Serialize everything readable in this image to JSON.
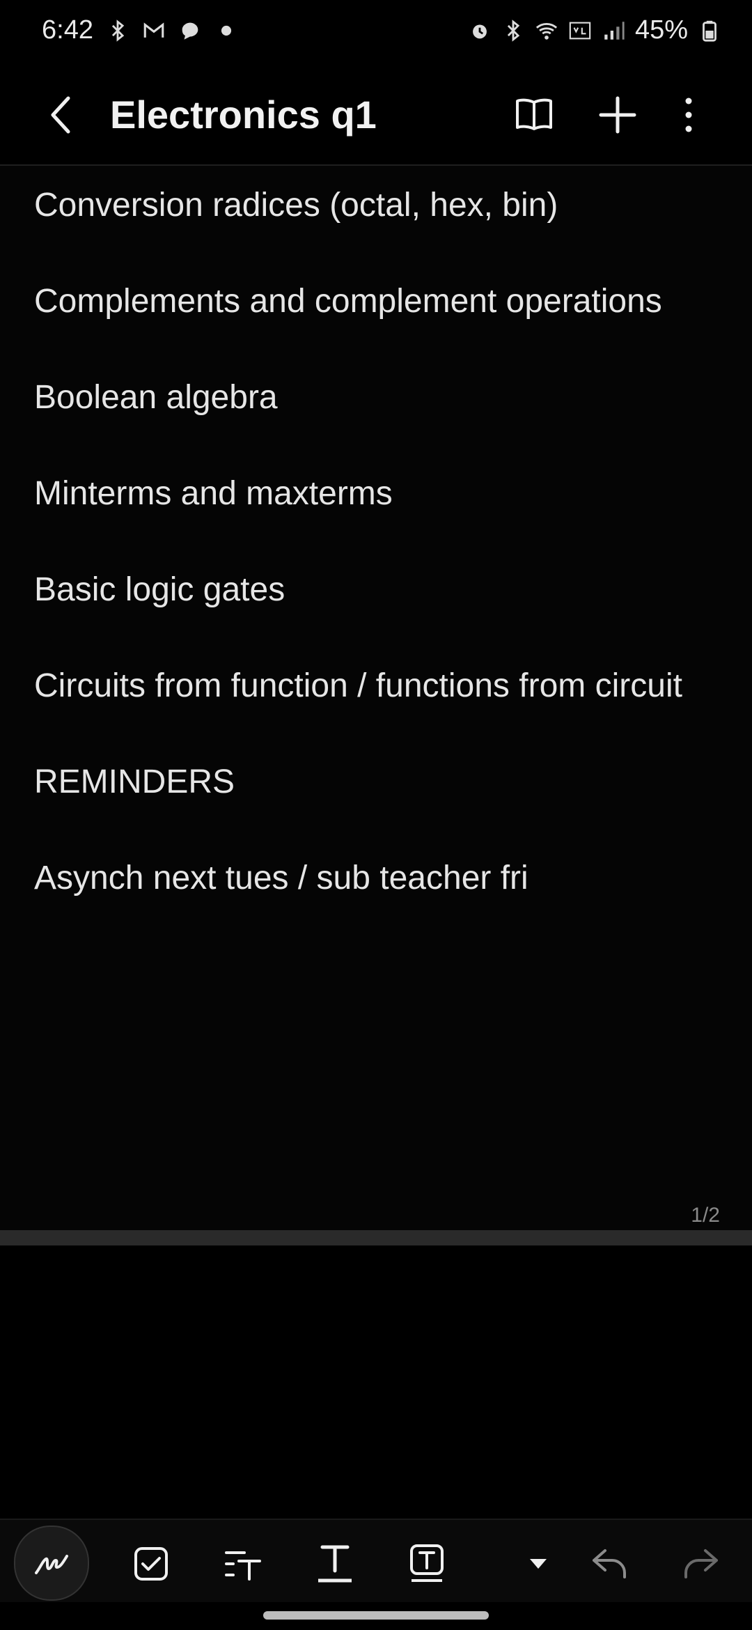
{
  "status_bar": {
    "time": "6:42",
    "battery": "45%",
    "left_icons": [
      "bluetooth-icon",
      "gmail-icon",
      "messages-icon",
      "dot-icon"
    ],
    "right_icons": [
      "alarm-icon",
      "bluetooth-icon",
      "wifi-icon",
      "volte-icon",
      "signal-icon",
      "battery-icon"
    ]
  },
  "app_bar": {
    "title": "Electronics q1"
  },
  "note": {
    "lines": [
      "Conversion radices (octal, hex, bin)",
      "Complements and complement operations",
      "Boolean algebra",
      "Minterms and maxterms",
      "Basic logic gates",
      "Circuits from function / functions from circuit",
      "REMINDERS",
      "Asynch next tues / sub teacher fri"
    ],
    "page_indicator": "1/2"
  },
  "toolbar": {
    "tools": [
      "pen-icon",
      "checkbox-icon",
      "text-style-icon",
      "text-format-icon",
      "text-box-icon",
      "dropdown-icon",
      "undo-icon",
      "redo-icon"
    ]
  }
}
